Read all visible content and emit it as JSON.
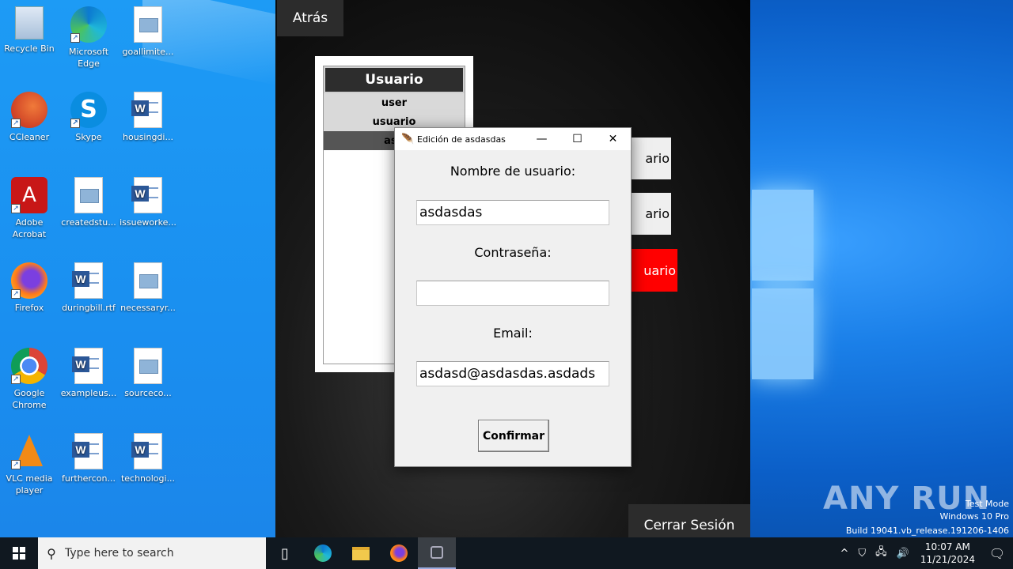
{
  "desktop": {
    "icons": [
      {
        "label": "Recycle Bin",
        "icon": "recycle-bin-icon"
      },
      {
        "label": "Microsoft Edge",
        "icon": "edge-icon"
      },
      {
        "label": "goallimite...",
        "icon": "image-file-icon"
      },
      {
        "label": "CCleaner",
        "icon": "ccleaner-icon"
      },
      {
        "label": "Skype",
        "icon": "skype-icon"
      },
      {
        "label": "housingdi...",
        "icon": "word-doc-icon"
      },
      {
        "label": "Adobe Acrobat",
        "icon": "acrobat-icon"
      },
      {
        "label": "createdstu...",
        "icon": "image-file-icon"
      },
      {
        "label": "issueworke...",
        "icon": "word-doc-icon"
      },
      {
        "label": "Firefox",
        "icon": "firefox-icon"
      },
      {
        "label": "duringbill.rtf",
        "icon": "word-doc-icon"
      },
      {
        "label": "necessaryr...",
        "icon": "image-file-icon"
      },
      {
        "label": "Google Chrome",
        "icon": "chrome-icon"
      },
      {
        "label": "exampleus...",
        "icon": "word-doc-icon"
      },
      {
        "label": "sourceco...",
        "icon": "image-file-icon"
      },
      {
        "label": "VLC media player",
        "icon": "vlc-icon"
      },
      {
        "label": "furthercon...",
        "icon": "word-doc-icon"
      },
      {
        "label": "technologi...",
        "icon": "word-doc-icon"
      }
    ]
  },
  "app": {
    "back_label": "Atrás",
    "list": {
      "header": "Usuario",
      "rows": [
        "user",
        "usuario",
        "asd"
      ]
    },
    "side_buttons": [
      "ario",
      "ario",
      "uario"
    ],
    "logout_label": "Cerrar Sesión"
  },
  "dialog": {
    "title": "Edición de asdasdas",
    "controls": {
      "minimize": "—",
      "maximize": "☐",
      "close": "✕"
    },
    "username_label": "Nombre de usuario:",
    "username_value": "asdasdas",
    "password_label": "Contraseña:",
    "password_value": "",
    "email_label": "Email:",
    "email_value": "asdasd@asdasdas.asdads",
    "confirm_label": "Confirmar"
  },
  "watermark": {
    "brand": "ANY RUN",
    "line1": "Test Mode",
    "line2": "Windows 10 Pro",
    "line3": "Build 19041.vb_release.191206-1406"
  },
  "taskbar": {
    "search_placeholder": "Type here to search",
    "time": "10:07 AM",
    "date": "11/21/2024"
  }
}
